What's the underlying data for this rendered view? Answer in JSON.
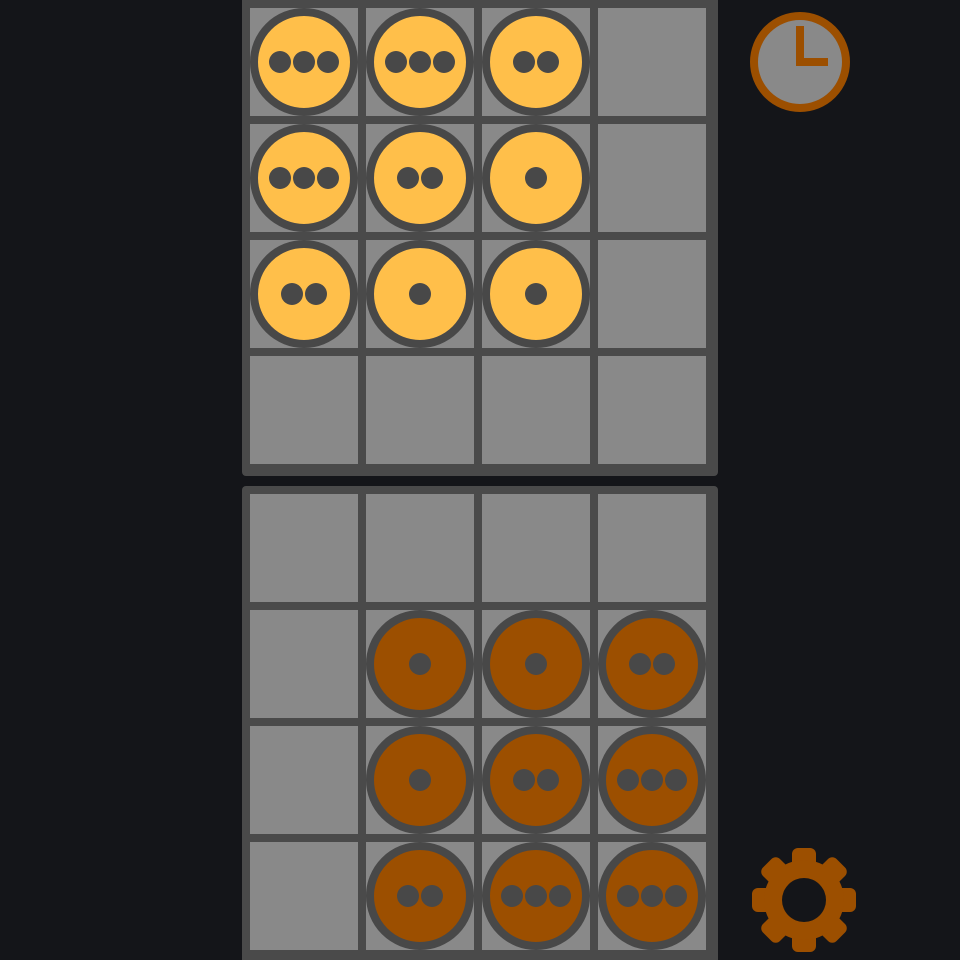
{
  "colors": {
    "background": "#141519",
    "board_frame": "#4a4a4a",
    "cell": "#898989",
    "player_top": "#ffbf4a",
    "player_bottom": "#9c4f00",
    "piece_outline": "#484848",
    "clock_face": "#898989",
    "accent": "#9c4f00"
  },
  "icons": {
    "timer": "clock-icon",
    "settings": "gear-icon"
  },
  "boards": {
    "top": {
      "piece_color": "#ffbf4a",
      "cells": [
        [
          3,
          3,
          2,
          0
        ],
        [
          3,
          2,
          1,
          0
        ],
        [
          2,
          1,
          1,
          0
        ],
        [
          0,
          0,
          0,
          0
        ]
      ]
    },
    "bottom": {
      "piece_color": "#9c4f00",
      "cells": [
        [
          0,
          0,
          0,
          0
        ],
        [
          0,
          1,
          1,
          2
        ],
        [
          0,
          1,
          2,
          3
        ],
        [
          0,
          2,
          3,
          3
        ]
      ]
    }
  }
}
